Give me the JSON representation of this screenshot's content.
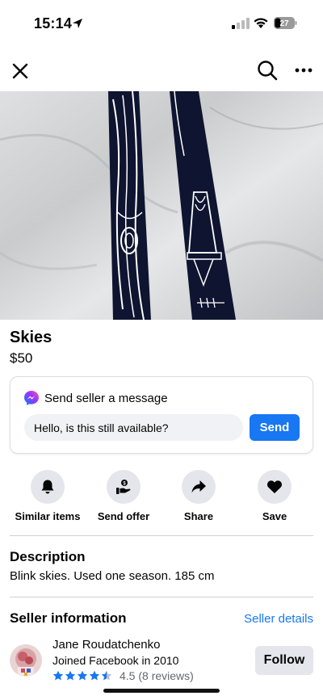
{
  "status_bar": {
    "time": "15:14",
    "battery": "27"
  },
  "listing": {
    "title": "Skies",
    "price": "$50",
    "photo_count": 4,
    "active_photo_index": 0
  },
  "message": {
    "heading": "Send seller a message",
    "input_value": "Hello, is this still available?",
    "send_label": "Send"
  },
  "actions": [
    {
      "label": "Similar items",
      "icon": "bell-icon"
    },
    {
      "label": "Send offer",
      "icon": "offer-icon"
    },
    {
      "label": "Share",
      "icon": "share-icon"
    },
    {
      "label": "Save",
      "icon": "heart-icon"
    }
  ],
  "description": {
    "heading": "Description",
    "text": "Blink skies. Used one season. 185 cm"
  },
  "seller": {
    "heading": "Seller information",
    "details_link": "Seller details",
    "name": "Jane Roudatchenko",
    "joined": "Joined Facebook in 2010",
    "rating": 4.5,
    "rating_text": "4.5 (8 reviews)",
    "follow_label": "Follow"
  },
  "colors": {
    "accent": "#1877f2",
    "button_gray": "#e4e6eb",
    "input_gray": "#f0f2f5"
  }
}
